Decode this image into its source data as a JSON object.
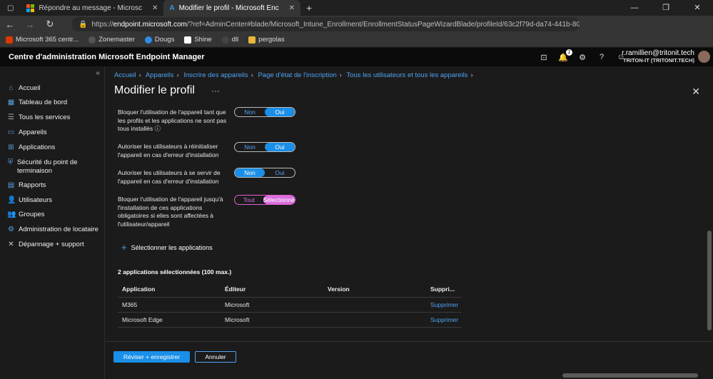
{
  "browser": {
    "tabs": [
      {
        "title": "Répondre au message - Microsc",
        "icon": "microsoft-logo-icon"
      },
      {
        "title": "Modifier le profil - Microsoft Enc",
        "icon": "azure-icon"
      }
    ],
    "url_prefix": "https://",
    "url_host": "endpoint.microsoft.com",
    "url_rest": "/?ref=AdminCenter#blade/Microsoft_Intune_Enrollment/EnrollmentStatusPageWizardBlade/profileId/63c2f79d-da74-441b-80...",
    "bookmarks": [
      {
        "label": "Microsoft 365 centr...",
        "color": "#d83b01"
      },
      {
        "label": "Zonemaster",
        "color": "#222222"
      },
      {
        "label": "Dougs",
        "color": "#2d8ce8"
      },
      {
        "label": "Shine",
        "color": "#ffffff"
      },
      {
        "label": "dll",
        "color": "#333333"
      },
      {
        "label": "pergolas",
        "color": "#e8b838"
      }
    ]
  },
  "app": {
    "title": "Centre d'administration Microsoft Endpoint Manager",
    "notification_count": "1",
    "user_name": "r.ramillien@tritonit.tech",
    "tenant": "TRITON-IT (TRITONIT.TECH)"
  },
  "sidebar": {
    "items": [
      {
        "label": "Accueil",
        "icon": "home-icon"
      },
      {
        "label": "Tableau de bord",
        "icon": "dashboard-icon"
      },
      {
        "label": "Tous les services",
        "icon": "list-icon"
      },
      {
        "label": "Appareils",
        "icon": "devices-icon"
      },
      {
        "label": "Applications",
        "icon": "apps-grid-icon"
      },
      {
        "label": "Sécurité du point de terminaison",
        "icon": "shield-icon"
      },
      {
        "label": "Rapports",
        "icon": "reports-icon"
      },
      {
        "label": "Utilisateurs",
        "icon": "user-icon"
      },
      {
        "label": "Groupes",
        "icon": "group-icon"
      },
      {
        "label": "Administration de locataire",
        "icon": "tenant-admin-icon"
      },
      {
        "label": "Dépannage + support",
        "icon": "wrench-icon"
      }
    ]
  },
  "breadcrumb": [
    "Accueil",
    "Appareils",
    "Inscrire des appareils",
    "Page d'état de l'inscription",
    "Tous les utilisateurs et tous les appareils"
  ],
  "page": {
    "title": "Modifier le profil"
  },
  "settings": [
    {
      "label": "Bloquer l'utilisation de l'appareil tant que les profils et les applications ne sont pas tous installés ⓘ",
      "options": [
        "Non",
        "Oui"
      ],
      "selected": "Oui"
    },
    {
      "label": "Autoriser les utilisateurs à réinitialiser l'appareil en cas d'erreur d'installation",
      "options": [
        "Non",
        "Oui"
      ],
      "selected": "Oui"
    },
    {
      "label": "Autoriser les utilisateurs à se servir de l'appareil en cas d'erreur d'installation",
      "options": [
        "Non",
        "Oui"
      ],
      "selected": "Non"
    },
    {
      "label": "Bloquer l'utilisation de l'appareil jusqu'à l'installation de ces applications obligatoires si elles sont affectées à l'utilisateur/appareil",
      "options": [
        "Tout",
        "Sélectionné"
      ],
      "selected": "Sélectionné"
    }
  ],
  "select_apps_label": "Sélectionner les applications",
  "selected_count_label": "2 applications sélectionnées (100 max.)",
  "apps_table": {
    "headers": [
      "Application",
      "Éditeur",
      "Version",
      "Suppri..."
    ],
    "rows": [
      {
        "app": "M365",
        "publisher": "Microsoft",
        "version": "",
        "action": "Supprimer"
      },
      {
        "app": "Microsoft Edge",
        "publisher": "Microsoft",
        "version": "",
        "action": "Supprimer"
      }
    ]
  },
  "footer": {
    "primary": "Réviser + enregistrer",
    "secondary": "Annuler"
  },
  "colors": {
    "accent": "#1a8fe8",
    "link": "#4fa3f2",
    "selected_pink": "#d86fdc"
  }
}
